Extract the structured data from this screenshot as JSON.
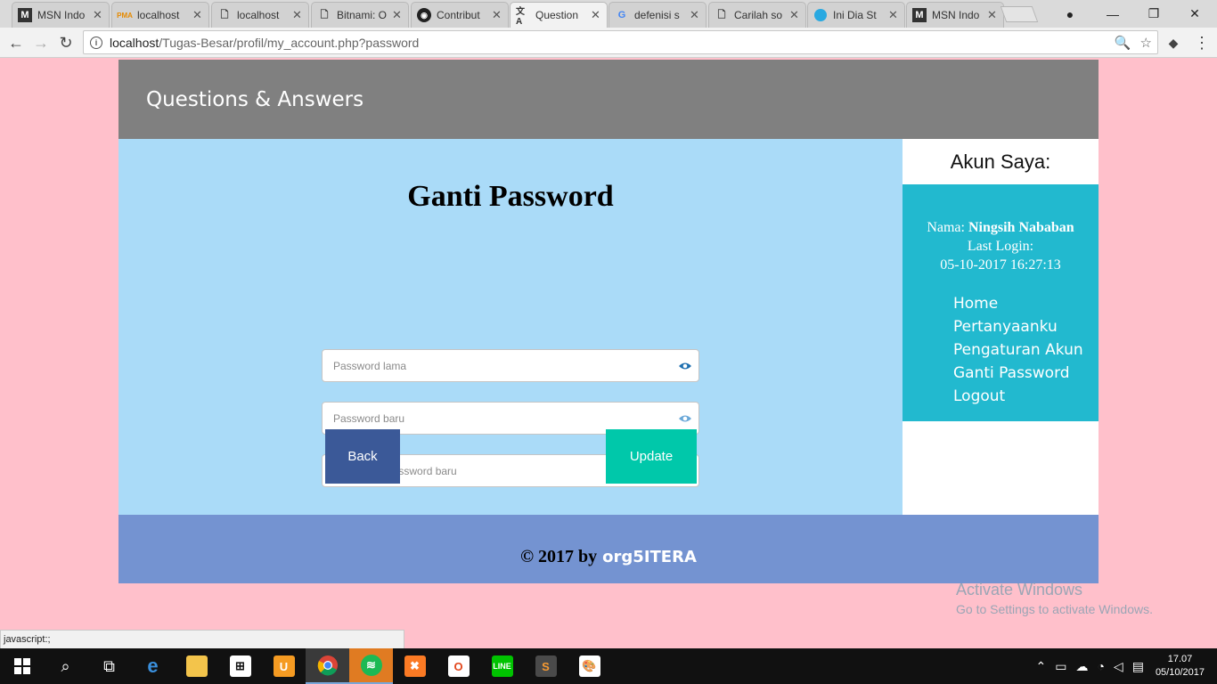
{
  "browser": {
    "tabs": [
      {
        "title": "MSN Indo",
        "icon": "msn-icon"
      },
      {
        "title": "localhost",
        "icon": "phpmyadmin-icon"
      },
      {
        "title": "localhost",
        "icon": "document-icon"
      },
      {
        "title": "Bitnami: O",
        "icon": "document-icon"
      },
      {
        "title": "Contribut",
        "icon": "github-icon"
      },
      {
        "title": "Question",
        "icon": "translate-icon"
      },
      {
        "title": "defenisi s",
        "icon": "google-icon"
      },
      {
        "title": "Carilah so",
        "icon": "document-icon"
      },
      {
        "title": "Ini Dia St",
        "icon": "blue-circle-icon"
      },
      {
        "title": "MSN Indo",
        "icon": "msn-icon"
      }
    ],
    "active_tab_index": 5,
    "url_host": "localhost",
    "url_path": "/Tugas-Besar/profil/my_account.php?password",
    "status_text": "javascript:;"
  },
  "site": {
    "title": "Questions & Answers"
  },
  "form": {
    "heading": "Ganti Password",
    "old_password_placeholder": "Password lama",
    "new_password_placeholder": "Password baru",
    "confirm_password_placeholder": "Konfirmasi password baru",
    "back_label": "Back",
    "update_label": "Update",
    "back_color": "#3b5998",
    "update_color": "#00c8aa"
  },
  "sidebar": {
    "title": "Akun Saya:",
    "name_label": "Nama:",
    "name_value": "Ningsih Nababan",
    "last_login_label": "Last Login:",
    "last_login_value": "05-10-2017 16:27:13",
    "nav": [
      "Home",
      "Pertanyaanku",
      "Pengaturan Akun",
      "Ganti Password",
      "Logout"
    ]
  },
  "footer": {
    "text": "© 2017 by",
    "brand": "org5ITERA"
  },
  "watermark": {
    "line1": "Activate Windows",
    "line2": "Go to Settings to activate Windows."
  },
  "taskbar": {
    "time": "17.07",
    "date": "05/10/2017"
  },
  "colors": {
    "page_bg": "#ffc0cb",
    "header_bg": "#808080",
    "content_bg": "#aadbf8",
    "sidebar_box": "#22b9cf",
    "footer_bg": "#7493d1"
  }
}
